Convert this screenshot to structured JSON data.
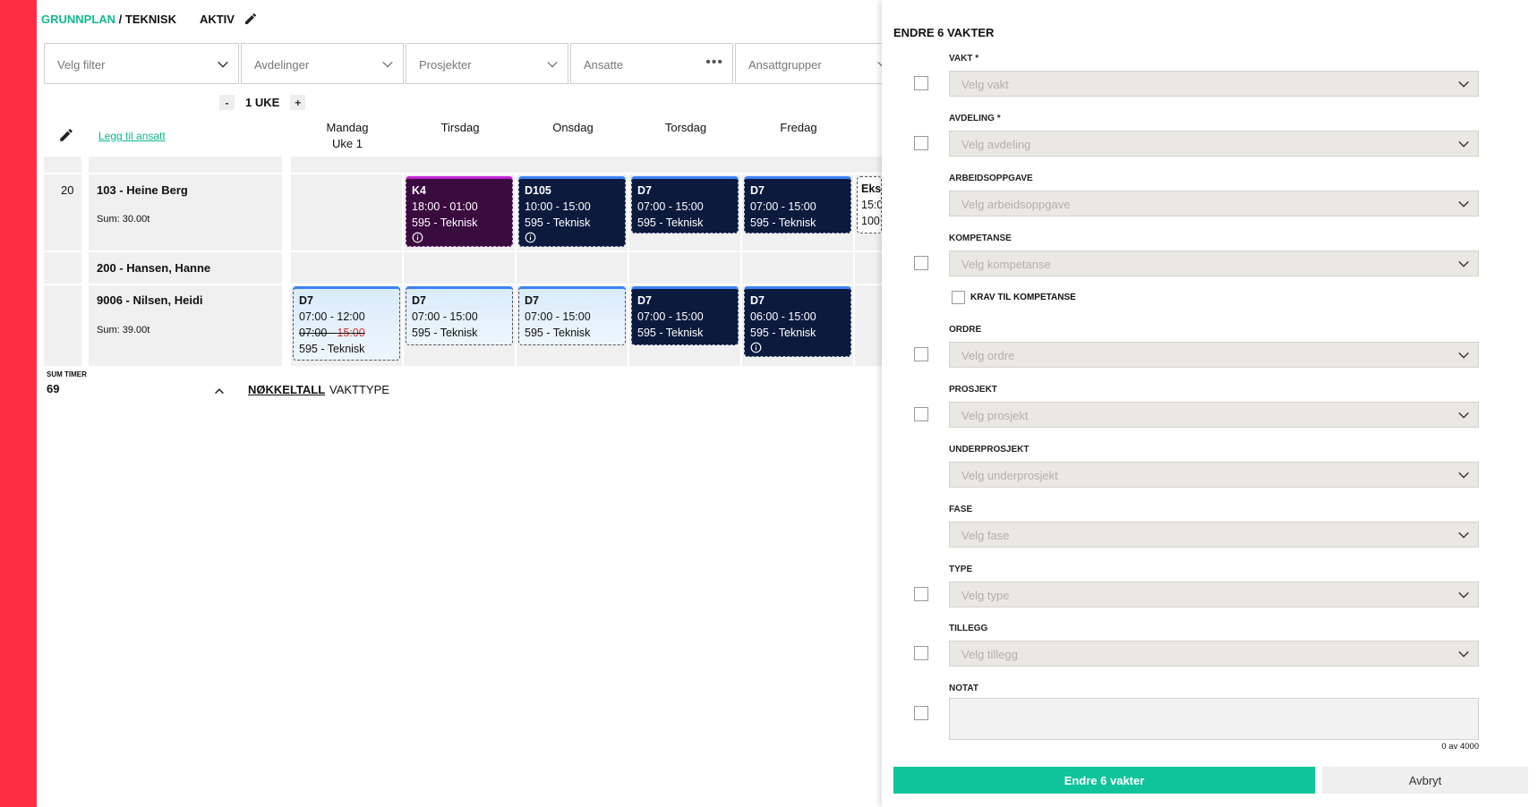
{
  "header": {
    "crumb_plan": "GRUNNPLAN",
    "crumb_sep": " / ",
    "crumb_dept": "TEKNISK",
    "status": "AKTIV"
  },
  "filters": [
    {
      "label": "Velg filter",
      "icon": "chevron-down-icon"
    },
    {
      "label": "Avdelinger",
      "icon": "chevron-down-icon"
    },
    {
      "label": "Prosjekter",
      "icon": "chevron-down-icon"
    },
    {
      "label": "Ansatte",
      "icon": "more-icon"
    },
    {
      "label": "Ansattgrupper",
      "icon": "chevron-down-icon"
    }
  ],
  "week": {
    "minus": "-",
    "label": "1 UKE",
    "plus": "+"
  },
  "add_employee": "Legg til ansatt",
  "days": [
    {
      "name": "Mandag",
      "sub": "Uke 1"
    },
    {
      "name": "Tirsdag",
      "sub": ""
    },
    {
      "name": "Onsdag",
      "sub": ""
    },
    {
      "name": "Torsdag",
      "sub": ""
    },
    {
      "name": "Fredag",
      "sub": ""
    }
  ],
  "employees": [
    {
      "row": "20",
      "name": "103 - Heine Berg",
      "sum": "Sum: 30.00t"
    },
    {
      "row": "",
      "name": "200 - Hansen, Hanne",
      "sum": ""
    },
    {
      "row": "",
      "name": "9006 - Nilsen, Heidi",
      "sum": "Sum: 39.00t"
    }
  ],
  "shifts": {
    "r1_tue": {
      "code": "K4",
      "time": "18:00 - 01:00",
      "dept": "595 - Teknisk"
    },
    "r1_wed": {
      "code": "D105",
      "time": "10:00 - 15:00",
      "dept": "595 - Teknisk"
    },
    "r1_thu": {
      "code": "D7",
      "time": "07:00 - 15:00",
      "dept": "595 - Teknisk"
    },
    "r1_fri": {
      "code": "D7",
      "time": "07:00 - 15:00",
      "dept": "595 - Teknisk"
    },
    "r1_sat": {
      "code": "Eks",
      "time": "15:0",
      "dept": "100"
    },
    "r3_mon": {
      "code": "D7",
      "time": "07:00 - 12:00",
      "old_start": "07:00 - ",
      "old_end": "15:00",
      "dept": "595 - Teknisk"
    },
    "r3_tue": {
      "code": "D7",
      "time": "07:00 - 15:00",
      "dept": "595 - Teknisk"
    },
    "r3_wed": {
      "code": "D7",
      "time": "07:00 - 15:00",
      "dept": "595 - Teknisk"
    },
    "r3_thu": {
      "code": "D7",
      "time": "07:00 - 15:00",
      "dept": "595 - Teknisk"
    },
    "r3_fri": {
      "code": "D7",
      "time": "06:00 - 15:00",
      "dept": "595 - Teknisk"
    }
  },
  "summary": {
    "label": "SUM TIMER",
    "value": "69",
    "tab_active": "NØKKELTALL",
    "tab_other": "VAKTTYPE"
  },
  "panel": {
    "title": "ENDRE 6 VAKTER",
    "fields": {
      "vakt": {
        "label": "VAKT *",
        "placeholder": "Velg vakt"
      },
      "avdeling": {
        "label": "AVDELING *",
        "placeholder": "Velg avdeling"
      },
      "arbeidsoppgave": {
        "label": "ARBEIDSOPPGAVE",
        "placeholder": "Velg arbeidsoppgave"
      },
      "kompetanse": {
        "label": "KOMPETANSE",
        "placeholder": "Velg kompetanse"
      },
      "ordre": {
        "label": "ORDRE",
        "placeholder": "Velg ordre"
      },
      "prosjekt": {
        "label": "PROSJEKT",
        "placeholder": "Velg prosjekt"
      },
      "underprosjekt": {
        "label": "UNDERPROSJEKT",
        "placeholder": "Velg underprosjekt"
      },
      "fase": {
        "label": "FASE",
        "placeholder": "Velg fase"
      },
      "type": {
        "label": "TYPE",
        "placeholder": "Velg type"
      },
      "tillegg": {
        "label": "TILLEGG",
        "placeholder": "Velg tillegg"
      }
    },
    "krav": "KRAV TIL KOMPETANSE",
    "notat_label": "NOTAT",
    "counter": "0 av 4000",
    "submit": "Endre 6 vakter",
    "cancel": "Avbryt"
  },
  "colors": {
    "accent": "#0fc49b",
    "sidebar": "#ff2d44",
    "shift_dark": "#0c1a3e",
    "shift_purple": "#3a0b3e"
  }
}
